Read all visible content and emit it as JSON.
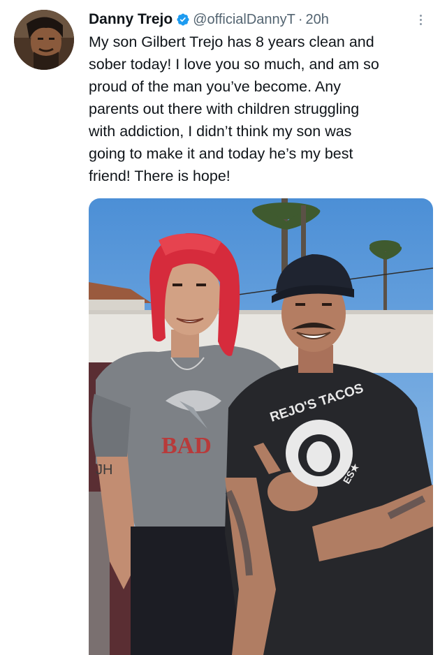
{
  "tweet": {
    "author_name": "Danny Trejo",
    "handle": "@officialDannyT",
    "separator": "·",
    "time": "20h",
    "text_lines": [
      "My son Gilbert Trejo has 8 years clean and",
      "sober today! I love you so much, and am so",
      "proud of the man you’ve become. Any",
      "parents out there with children struggling",
      "with addiction, I didn’t think my son was",
      "going to make it and today he’s my best",
      "friend! There is hope!"
    ],
    "shirt_text": {
      "top": "REJO'S TACOS",
      "bottom": "ES★"
    }
  },
  "icons": {
    "verified": "verified-badge-icon",
    "more": "more-options-icon"
  },
  "colors": {
    "verified_blue": "#1d9bf0",
    "secondary_text": "#536471",
    "primary_text": "#0f1419"
  }
}
